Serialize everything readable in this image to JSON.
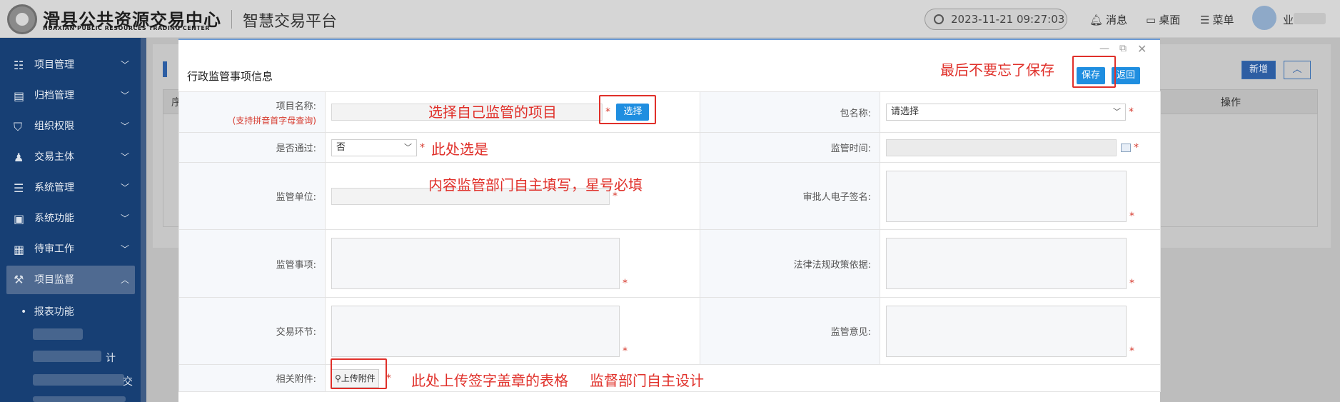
{
  "header": {
    "logo_title": "滑县公共资源交易中心",
    "logo_subtitle": "HUAXIAN PUBLIC RESOURCES TRADING CENTER",
    "platform_name": "智慧交易平台",
    "datetime": "2023-11-21 09:27:03",
    "messages_label": "消息",
    "desktop_label": "桌面",
    "menu_label": "菜单",
    "user_name_partial": "业"
  },
  "sidebar": {
    "items": [
      {
        "label": "项目管理",
        "icon": "list-icon"
      },
      {
        "label": "归档管理",
        "icon": "archive-icon"
      },
      {
        "label": "组织权限",
        "icon": "shield-icon"
      },
      {
        "label": "交易主体",
        "icon": "users-icon"
      },
      {
        "label": "系统管理",
        "icon": "settings-list-icon"
      },
      {
        "label": "系统功能",
        "icon": "monitor-icon"
      },
      {
        "label": "待审工作",
        "icon": "calendar-icon"
      },
      {
        "label": "项目监督",
        "icon": "hammer-icon",
        "active": true
      }
    ],
    "subitems": [
      {
        "label": "报表功能"
      },
      {
        "label": "计"
      },
      {
        "label": "交"
      }
    ]
  },
  "background": {
    "add_button": "新增",
    "column_seq": "序",
    "column_op": "操作"
  },
  "modal": {
    "title": "行政监管事项信息",
    "save_label": "保存",
    "back_label": "返回",
    "fields": {
      "project_name_label": "项目名称:",
      "project_name_hint": "(支持拼音首字母查询)",
      "select_button": "选择",
      "package_label": "包名称:",
      "package_placeholder": "请选择",
      "passed_label": "是否通过:",
      "passed_value": "否",
      "time_label": "监管时间:",
      "unit_label": "监管单位:",
      "signature_label": "审批人电子签名:",
      "matters_label": "监管事项:",
      "law_label": "法律法规政策依据:",
      "stage_label": "交易环节:",
      "opinion_label": "监管意见:",
      "attachment_label": "相关附件:",
      "upload_button": "上传附件"
    },
    "required_mark": "*"
  },
  "annotations": {
    "save_note": "最后不要忘了保存",
    "select_note": "选择自己监管的项目",
    "passed_note": "此处选是",
    "required_note": "内容监管部门自主填写，星号必填",
    "upload_note": "此处上传签字盖章的表格",
    "design_note": "监督部门自主设计"
  },
  "colors": {
    "sidebar_bg": "#173f74",
    "primary_button": "#1f8ee0",
    "annotation_red": "#e0302a",
    "modal_accent": "#6b9bd6"
  }
}
